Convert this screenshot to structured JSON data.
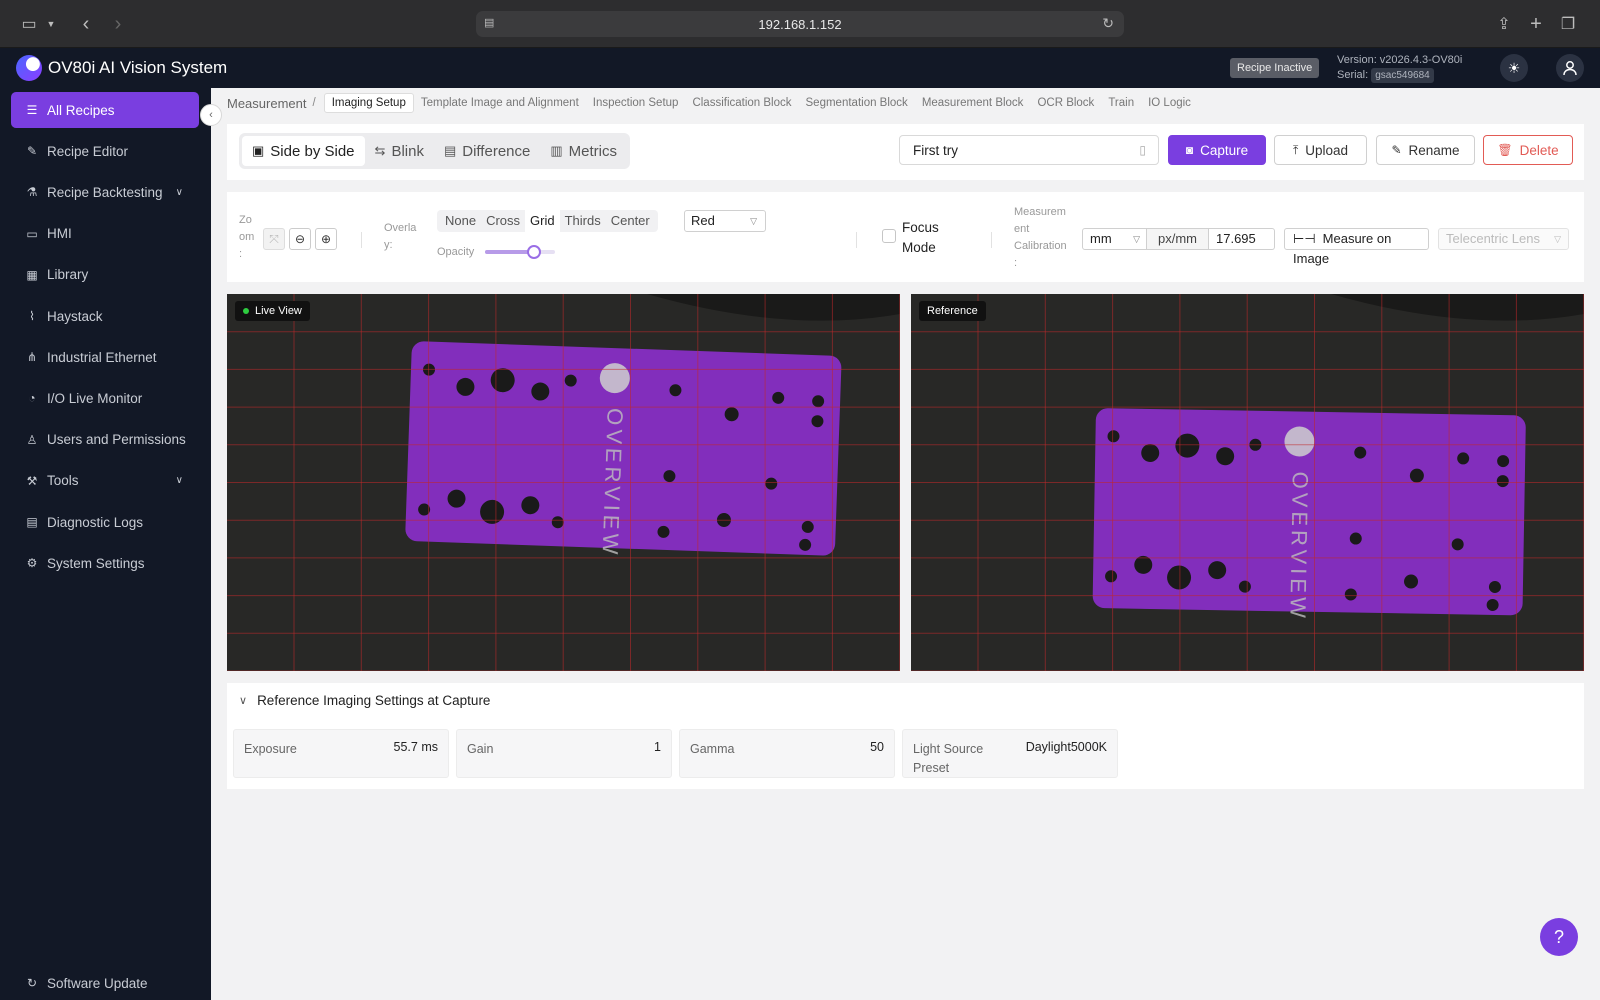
{
  "browser": {
    "url": "192.168.1.152"
  },
  "app": {
    "title": "OV80i AI Vision System",
    "recipe_status": "Recipe Inactive",
    "version": "Version: v2026.4.3-OV80i",
    "serial_label": "Serial:",
    "serial_value": "gsac549684"
  },
  "sidebar": {
    "items": [
      {
        "label": "All Recipes",
        "icon": "list-icon",
        "active": true
      },
      {
        "label": "Recipe Editor",
        "icon": "pencil-icon"
      },
      {
        "label": "Recipe Backtesting",
        "icon": "flask-icon",
        "expandable": true
      },
      {
        "label": "HMI",
        "icon": "monitor-icon"
      },
      {
        "label": "Library",
        "icon": "table-icon"
      },
      {
        "label": "Haystack",
        "icon": "chart-icon"
      },
      {
        "label": "Industrial Ethernet",
        "icon": "network-icon"
      },
      {
        "label": "I/O Live Monitor",
        "icon": "gauge-icon"
      },
      {
        "label": "Users and Permissions",
        "icon": "user-icon"
      },
      {
        "label": "Tools",
        "icon": "wrench-icon",
        "expandable": true
      },
      {
        "label": "Diagnostic Logs",
        "icon": "log-icon"
      },
      {
        "label": "System Settings",
        "icon": "gear-icon"
      }
    ],
    "footer": "Software Update"
  },
  "breadcrumb": {
    "root": "Measurement",
    "separator": "/",
    "tabs": [
      "Imaging Setup",
      "Template Image and Alignment",
      "Inspection Setup",
      "Classification Block",
      "Segmentation Block",
      "Measurement Block",
      "OCR Block",
      "Train",
      "IO Logic"
    ],
    "active_tab": "Imaging Setup"
  },
  "view_modes": [
    {
      "label": "Side by Side",
      "icon": "image-icon",
      "active": true
    },
    {
      "label": "Blink",
      "icon": "swap-icon"
    },
    {
      "label": "Difference",
      "icon": "diff-icon"
    },
    {
      "label": "Metrics",
      "icon": "bar-chart-icon"
    }
  ],
  "capture_name": "First try",
  "actions": {
    "capture": "Capture",
    "upload": "Upload",
    "rename": "Rename",
    "delete": "Delete"
  },
  "controls": {
    "zoom_label": [
      "Zo",
      "om",
      ":"
    ],
    "overlay_label": [
      "Overla",
      "y:"
    ],
    "overlay_options": [
      "None",
      "Cross",
      "Grid",
      "Thirds",
      "Center"
    ],
    "overlay_active": "Grid",
    "overlay_color": "Red",
    "opacity_label": "Opacity",
    "opacity_fraction": 0.7,
    "focus_mode": "Focus Mode",
    "focus_mode_checked": false,
    "calibration_label": [
      "Measurem",
      "ent",
      "Calibration",
      ":"
    ],
    "unit": "mm",
    "unit_ratio": "px/mm",
    "calibration_value": "17.695",
    "measure_button": "Measure on Image",
    "lens_placeholder": "Telecentric Lens"
  },
  "cameras": {
    "live_label": "Live View",
    "reference_label": "Reference",
    "plate_text": "OVERVIEW"
  },
  "reference_settings": {
    "title": "Reference Imaging Settings at Capture",
    "items": [
      {
        "label": "Exposure",
        "value": "55.7 ms"
      },
      {
        "label": "Gain",
        "value": "1"
      },
      {
        "label": "Gamma",
        "value": "50"
      },
      {
        "label": "Light Source Preset",
        "value": "Daylight5000K"
      }
    ]
  },
  "colors": {
    "accent": "#7a3ee0",
    "sidebar_bg": "#121826",
    "danger": "#e25b55",
    "plate": "#8a2fc9"
  }
}
